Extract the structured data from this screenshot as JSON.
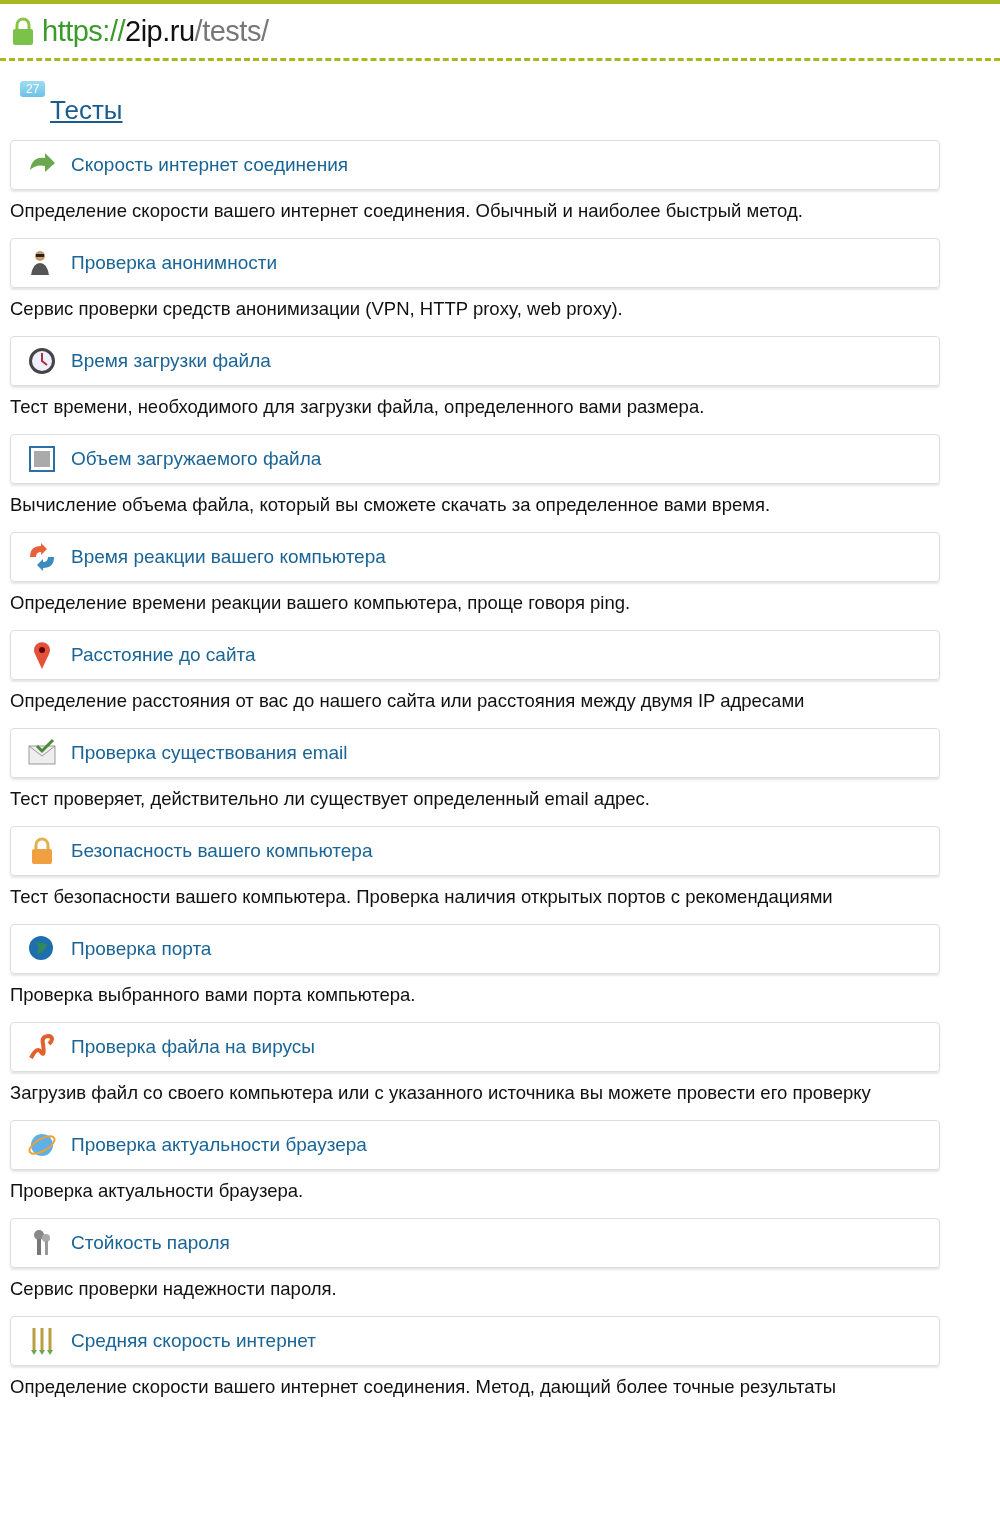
{
  "address_bar": {
    "scheme": "https://",
    "host": "2ip.ru",
    "path": "/tests/",
    "secure": true
  },
  "page": {
    "badge": "27",
    "title": "Тесты"
  },
  "tests": [
    {
      "kind": "speed",
      "title": "Скорость интернет соединения",
      "description": "Определение скорости вашего интернет соединения. Обычный и наиболее быстрый метод."
    },
    {
      "kind": "anonymity",
      "title": "Проверка анонимности",
      "description": "Сервис проверки средств анонимизации (VPN, HTTP proxy, web proxy)."
    },
    {
      "kind": "clock",
      "title": "Время загрузки файла",
      "description": "Тест времени, необходимого для загрузки файла, определенного вами размера."
    },
    {
      "kind": "frame",
      "title": "Объем загружаемого файла",
      "description": "Вычисление объема файла, который вы сможете скачать за определенное вами время."
    },
    {
      "kind": "ping",
      "title": "Время реакции вашего компьютера",
      "description": "Определение времени реакции вашего компьютера, проще говоря ping."
    },
    {
      "kind": "pin",
      "title": "Расстояние до сайта",
      "description": "Определение расстояния от вас до нашего сайта или расстояния между двумя IP адресами"
    },
    {
      "kind": "email",
      "title": "Проверка существования email",
      "description": "Тест проверяет, действительно ли существует определенный email адрес."
    },
    {
      "kind": "lock",
      "title": "Безопасность вашего компьютера",
      "description": "Тест безопасности вашего компьютера. Проверка наличия открытых портов с рекомендациями"
    },
    {
      "kind": "globe",
      "title": "Проверка порта",
      "description": "Проверка выбранного вами порта компьютера."
    },
    {
      "kind": "virus",
      "title": "Проверка файла на вирусы",
      "description": "Загрузив файл со своего компьютера или с указанного источника вы можете провести его проверку"
    },
    {
      "kind": "browser",
      "title": "Проверка актуальности браузера",
      "description": "Проверка актуальности браузера."
    },
    {
      "kind": "keys",
      "title": "Стойкость пароля",
      "description": "Сервис проверки надежности пароля."
    },
    {
      "kind": "bars",
      "title": "Средняя скорость интернет",
      "description": "Определение скорости вашего интернет соединения. Метод, дающий более точные результаты"
    }
  ]
}
